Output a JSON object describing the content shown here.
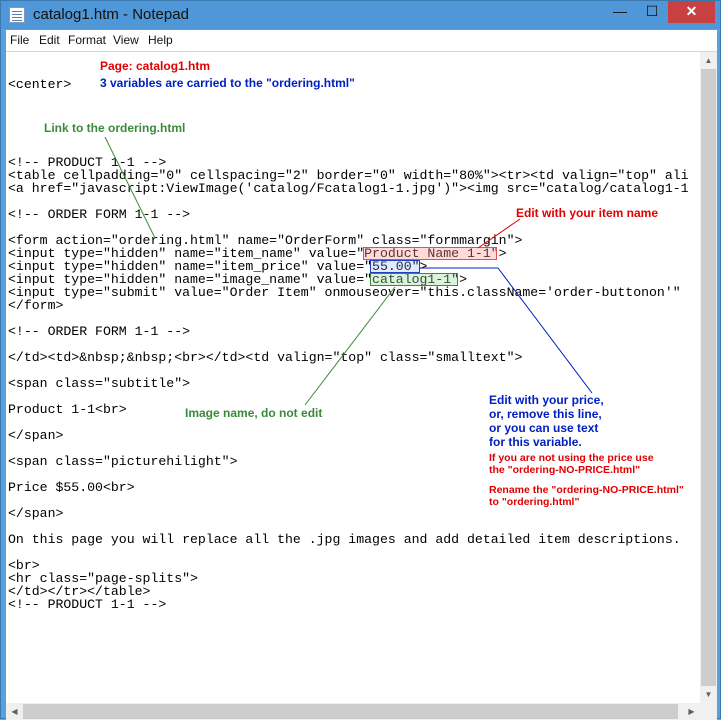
{
  "window": {
    "title": "catalog1.htm - Notepad",
    "controls": {
      "minimize": "—",
      "maximize": "☐",
      "close": "✕"
    }
  },
  "menu": [
    "File",
    "Edit",
    "Format",
    "View",
    "Help"
  ],
  "code_lines": [
    "",
    "",
    "<center>",
    "",
    "",
    "",
    "",
    "",
    "<!-- PRODUCT 1-1 -->",
    "<table cellpadding=\"0\" cellspacing=\"2\" border=\"0\" width=\"80%\"><tr><td valign=\"top\" ali",
    "<a href=\"javascript:ViewImage('catalog/Fcatalog1-1.jpg')\"><img src=\"catalog/catalog1-1",
    "",
    "<!-- ORDER FORM 1-1 -->",
    "",
    "<form action=\"ordering.html\" name=\"OrderForm\" class=\"formmargin\">",
    "<input type=\"hidden\" name=\"item_name\" value=\"Product Name 1-1\">",
    "<input type=\"hidden\" name=\"item_price\" value=\"55.00\">",
    "<input type=\"hidden\" name=\"image_name\" value=\"catalog1-1\">",
    "<input type=\"submit\" value=\"Order Item\" onmouseover=\"this.className='order-buttonon'\"",
    "</form>",
    "",
    "<!-- ORDER FORM 1-1 -->",
    "",
    "</td><td>&nbsp;&nbsp;<br></td><td valign=\"top\" class=\"smalltext\">",
    "",
    "<span class=\"subtitle\">",
    "",
    "Product 1-1<br>",
    "",
    "</span>",
    "",
    "<span class=\"picturehilight\">",
    "",
    "Price $55.00<br>",
    "",
    "</span>",
    "",
    "On this page you will replace all the .jpg images and add detailed item descriptions.",
    "",
    "<br>",
    "<hr class=\"page-splits\">",
    "</td></tr></table>",
    "<!-- PRODUCT 1-1 -->"
  ],
  "annotations": {
    "page_title": "Page: catalog1.htm",
    "variables": "3 variables are carried to the \"ordering.html\"",
    "link": "Link to the ordering.html",
    "item_name": "Edit with your item name",
    "image_name": "Image name, do not edit",
    "price": "Edit with your price,\nor, remove this line,\nor you can use text\nfor this variable.",
    "no_price": "If you are not using the price use\nthe \"ordering-NO-PRICE.html\"",
    "rename": "Rename the \"ordering-NO-PRICE.html\"\nto \"ordering.html\""
  },
  "colors": {
    "red": "#e00000",
    "blue": "#0020c0",
    "green": "#3a8a3a",
    "title_bar": "#4f97d6"
  }
}
